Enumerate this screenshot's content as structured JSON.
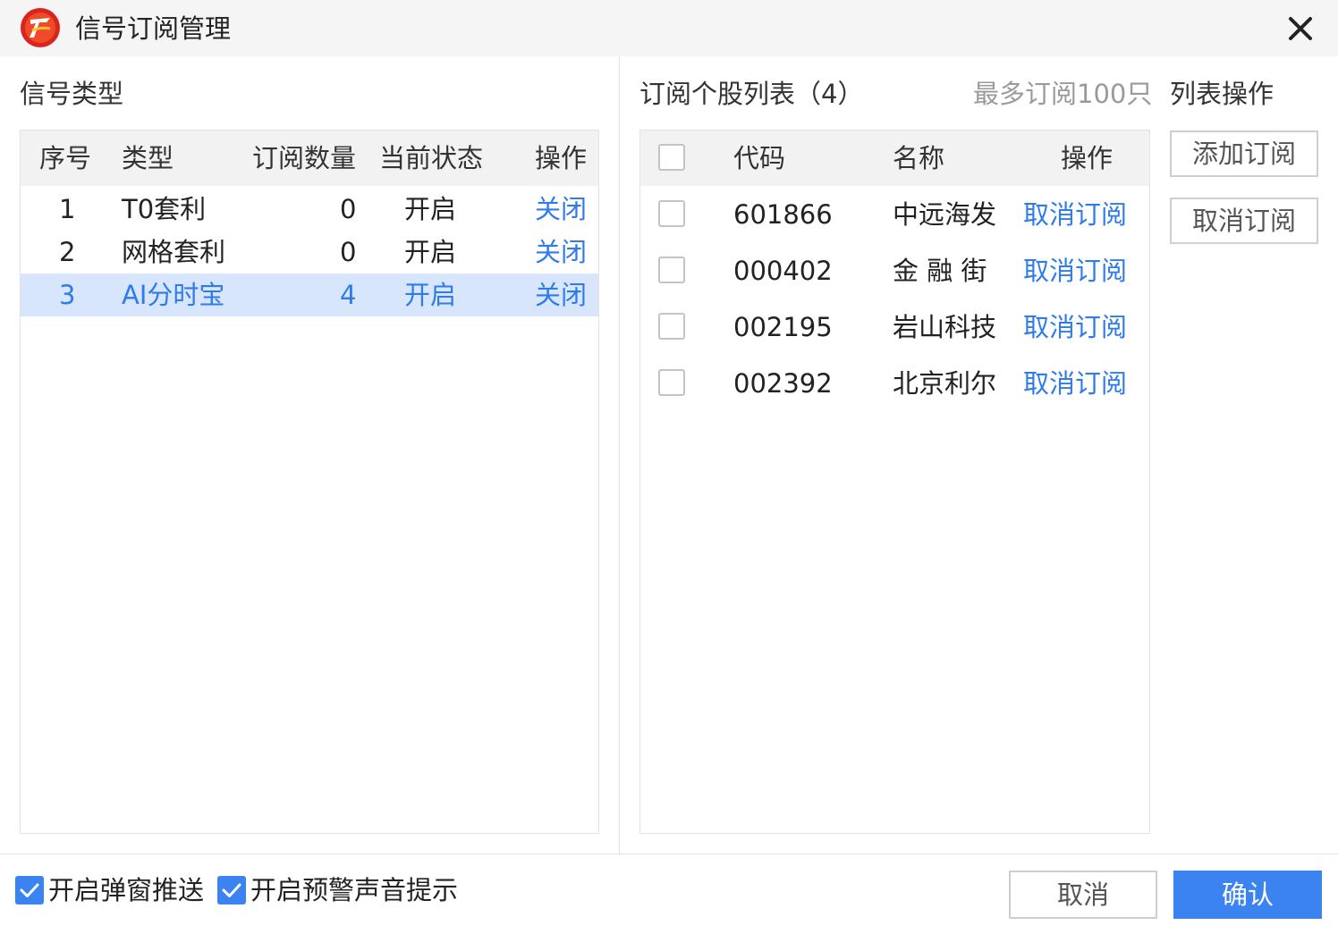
{
  "window": {
    "title": "信号订阅管理"
  },
  "left": {
    "section_title": "信号类型",
    "columns": {
      "index": "序号",
      "type": "类型",
      "count": "订阅数量",
      "status": "当前状态",
      "action": "操作"
    },
    "rows": [
      {
        "index": "1",
        "type": "T0套利",
        "count": "0",
        "status": "开启",
        "action": "关闭",
        "selected": false
      },
      {
        "index": "2",
        "type": "网格套利",
        "count": "0",
        "status": "开启",
        "action": "关闭",
        "selected": false
      },
      {
        "index": "3",
        "type": "AI分时宝",
        "count": "4",
        "status": "开启",
        "action": "关闭",
        "selected": true
      }
    ]
  },
  "right": {
    "section_title": "订阅个股列表（4）",
    "hint": "最多订阅100只",
    "columns": {
      "code": "代码",
      "name": "名称",
      "action": "操作"
    },
    "rows": [
      {
        "code": "601866",
        "name": "中远海发",
        "action": "取消订阅"
      },
      {
        "code": "000402",
        "name": "金 融 街",
        "action": "取消订阅"
      },
      {
        "code": "002195",
        "name": "岩山科技",
        "action": "取消订阅"
      },
      {
        "code": "002392",
        "name": "北京利尔",
        "action": "取消订阅"
      }
    ]
  },
  "list_ops": {
    "title": "列表操作",
    "add_label": "添加订阅",
    "remove_label": "取消订阅"
  },
  "footer": {
    "popup_push": {
      "label": "开启弹窗推送",
      "checked": true
    },
    "alert_sound": {
      "label": "开启预警声音提示",
      "checked": true
    },
    "cancel_label": "取消",
    "confirm_label": "确认"
  },
  "colors": {
    "accent": "#3b83f0",
    "link": "#2f7bea",
    "selected_row": "#d7e6fd"
  }
}
